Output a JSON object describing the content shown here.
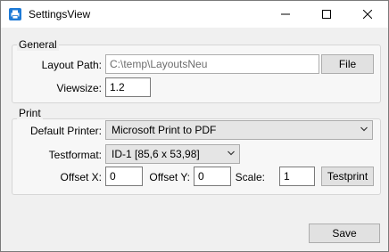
{
  "window": {
    "title": "SettingsView"
  },
  "general": {
    "label": "General",
    "layout_path_label": "Layout Path:",
    "layout_path_value": "C:\\temp\\LayoutsNeu",
    "file_button": "File",
    "viewsize_label": "Viewsize:",
    "viewsize_value": "1.2"
  },
  "print": {
    "label": "Print",
    "default_printer_label": "Default Printer:",
    "default_printer_value": "Microsoft Print to PDF",
    "testformat_label": "Testformat:",
    "testformat_value": "ID-1 [85,6 x 53,98]",
    "offset_x_label": "Offset X:",
    "offset_x_value": "0",
    "offset_y_label": "Offset Y:",
    "offset_y_value": "0",
    "scale_label": "Scale:",
    "scale_value": "1",
    "testprint_button": "Testprint"
  },
  "footer": {
    "save_button": "Save"
  },
  "icons": {
    "app": "printer-icon",
    "minimize": "minimize-icon",
    "maximize": "maximize-icon",
    "close": "close-icon",
    "dropdown": "chevron-down-icon"
  },
  "colors": {
    "app_icon": "#1e7ad6",
    "window_bg": "#f0f0f0",
    "titlebar_bg": "#ffffff"
  }
}
